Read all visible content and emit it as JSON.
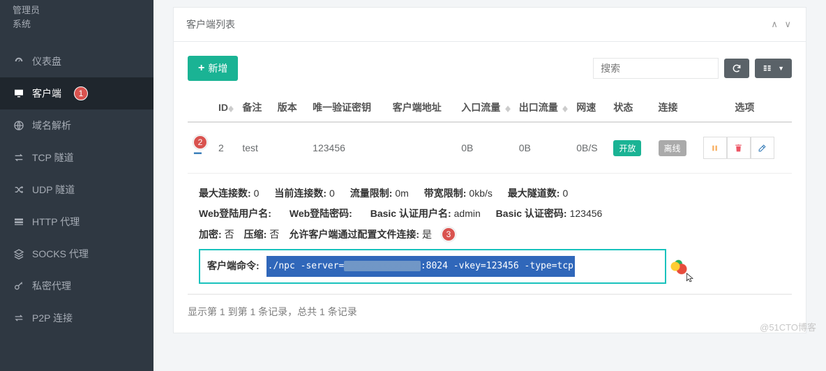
{
  "profile": {
    "role": "管理员",
    "mode": "系统"
  },
  "sidebar": {
    "items": [
      {
        "label": "仪表盘"
      },
      {
        "label": "客户端",
        "badge": "1"
      },
      {
        "label": "域名解析"
      },
      {
        "label": "TCP 隧道"
      },
      {
        "label": "UDP 隧道"
      },
      {
        "label": "HTTP 代理"
      },
      {
        "label": "SOCKS 代理"
      },
      {
        "label": "私密代理"
      },
      {
        "label": "P2P 连接"
      }
    ]
  },
  "panel": {
    "title": "客户端列表"
  },
  "toolbar": {
    "add": "新增",
    "search_placeholder": "搜索"
  },
  "columns": {
    "id": "ID",
    "remark": "备注",
    "version": "版本",
    "vkey": "唯一验证密钥",
    "addr": "客户端地址",
    "in": "入口流量",
    "out": "出口流量",
    "speed": "网速",
    "status": "状态",
    "conn": "连接",
    "options": "选项"
  },
  "row": {
    "badge": "2",
    "id": "2",
    "remark": "test",
    "version": "",
    "vkey": "123456",
    "addr": "",
    "in": "0B",
    "out": "0B",
    "speed": "0B/S",
    "status": "开放",
    "conn": "离线"
  },
  "details": {
    "max_conn_k": "最大连接数:",
    "max_conn_v": "0",
    "cur_conn_k": "当前连接数:",
    "cur_conn_v": "0",
    "flow_limit_k": "流量限制:",
    "flow_limit_v": "0m",
    "bw_limit_k": "带宽限制:",
    "bw_limit_v": "0kb/s",
    "max_tun_k": "最大隧道数:",
    "max_tun_v": "0",
    "web_user_k": "Web登陆用户名:",
    "web_user_v": "",
    "web_pass_k": "Web登陆密码:",
    "web_pass_v": "",
    "basic_user_k": "Basic 认证用户名:",
    "basic_user_v": "admin",
    "basic_pass_k": "Basic 认证密码:",
    "basic_pass_v": "123456",
    "enc_k": "加密:",
    "enc_v": "否",
    "zip_k": "压缩:",
    "zip_v": "否",
    "cfg_k": "允许客户端通过配置文件连接:",
    "cfg_v": "是",
    "badge3": "3",
    "cmd_k": "客户端命令:",
    "cmd_pre": "./npc -server=",
    "cmd_post": ":8024 -vkey=123456 -type=tcp"
  },
  "footer": {
    "info": "显示第 1 到第 1 条记录，总共 1 条记录"
  },
  "watermark": "@51CTO博客"
}
